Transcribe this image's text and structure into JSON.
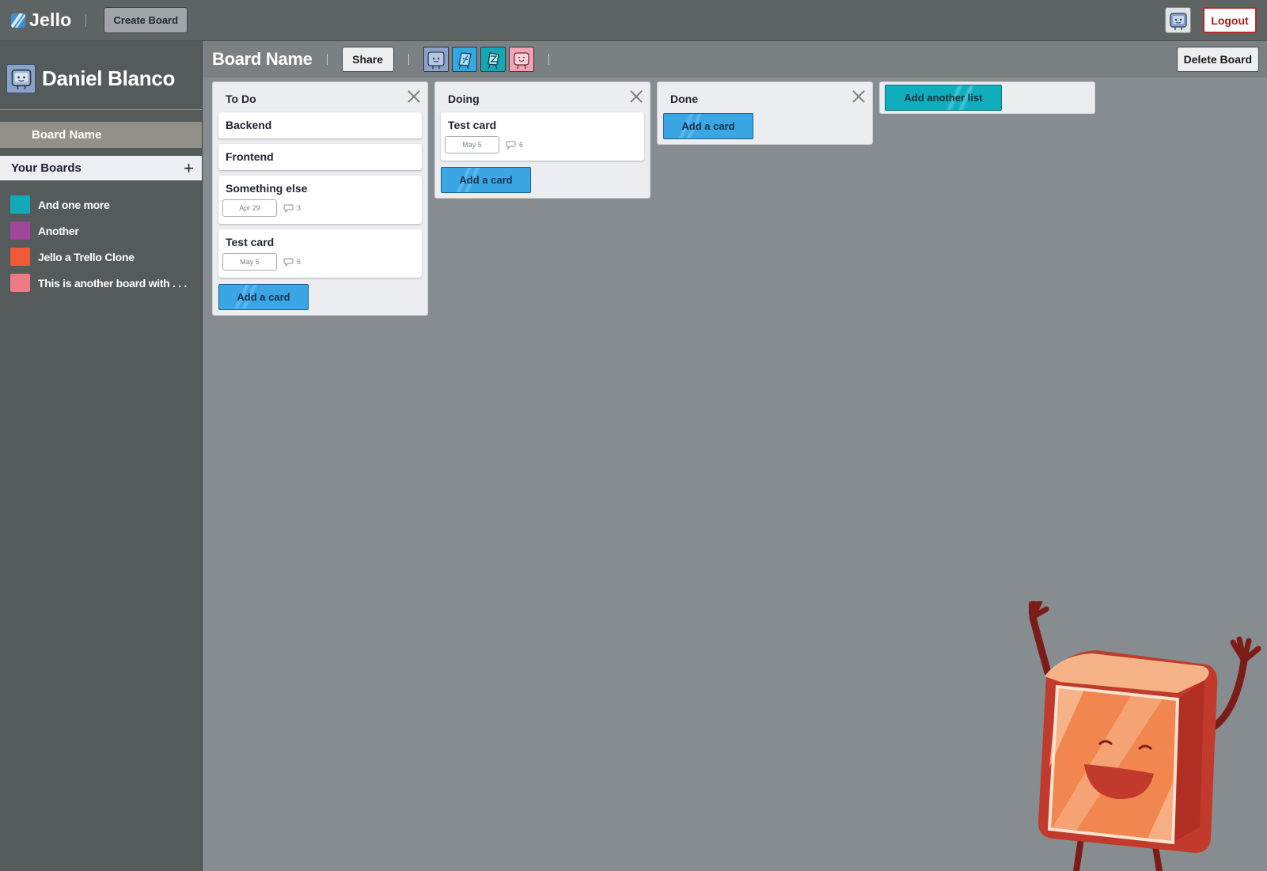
{
  "app": {
    "name": "Jello",
    "create_board_label": "Create Board",
    "logout_label": "Logout"
  },
  "sidebar": {
    "user_name": "Daniel Blanco",
    "current_board": "Board Name",
    "your_boards_label": "Your Boards",
    "add_symbol": "+",
    "boards": [
      {
        "label": "And one more",
        "color": "#14a9b8"
      },
      {
        "label": "Another",
        "color": "#a0479b"
      },
      {
        "label": "Jello a Trello Clone",
        "color": "#f05a3a"
      },
      {
        "label": "This is another board with . . .",
        "color": "#f07a84"
      }
    ]
  },
  "board": {
    "title": "Board Name",
    "share_label": "Share",
    "delete_label": "Delete Board",
    "members": [
      {
        "color": "#8ba3c8",
        "icon": "blue-avatar-icon"
      },
      {
        "color": "#34a8e0",
        "icon": "blue-pen-avatar-icon"
      },
      {
        "color": "#13a8b7",
        "icon": "teal-avatar-icon"
      },
      {
        "color": "#f3a3b3",
        "icon": "pink-avatar-icon"
      }
    ],
    "lists": [
      {
        "title": "To Do",
        "cards": [
          {
            "title": "Backend"
          },
          {
            "title": "Frontend"
          },
          {
            "title": "Something else",
            "date": "Apr 29",
            "comments": "3"
          },
          {
            "title": "Test card",
            "date": "May 5",
            "comments": "6"
          }
        ],
        "add_label": "Add a card"
      },
      {
        "title": "Doing",
        "cards": [
          {
            "title": "Test card",
            "date": "May 5",
            "comments": "6"
          }
        ],
        "add_label": "Add a card"
      },
      {
        "title": "Done",
        "cards": [],
        "add_label": "Add a card"
      }
    ],
    "add_list_label": "Add another list"
  }
}
